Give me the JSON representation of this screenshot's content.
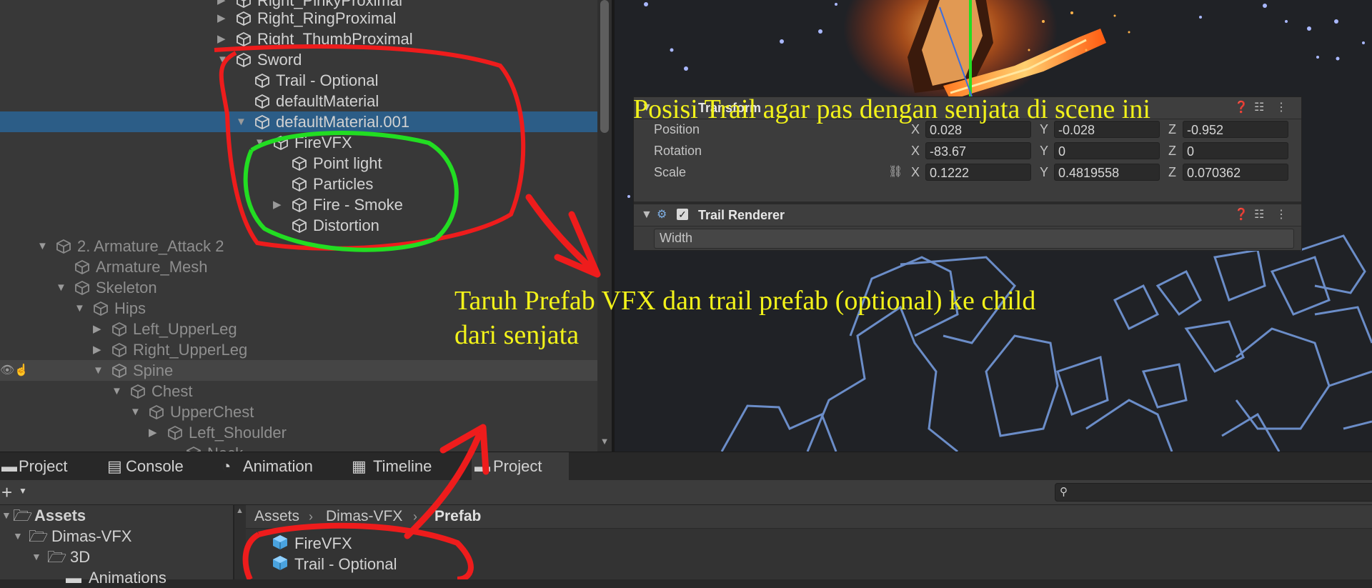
{
  "hierarchy": {
    "rows": [
      {
        "label": "Right_PinkyProximal"
      },
      {
        "label": "Right_RingProximal"
      },
      {
        "label": "Right_ThumbProximal"
      },
      {
        "label": "Sword"
      },
      {
        "label": "Trail - Optional"
      },
      {
        "label": "defaultMaterial"
      },
      {
        "label": "defaultMaterial.001"
      },
      {
        "label": "FireVFX"
      },
      {
        "label": "Point light"
      },
      {
        "label": "Particles"
      },
      {
        "label": "Fire - Smoke"
      },
      {
        "label": "Distortion"
      },
      {
        "label": "2. Armature_Attack 2"
      },
      {
        "label": "Armature_Mesh"
      },
      {
        "label": "Skeleton"
      },
      {
        "label": "Hips"
      },
      {
        "label": "Left_UpperLeg"
      },
      {
        "label": "Right_UpperLeg"
      },
      {
        "label": "Spine"
      },
      {
        "label": "Chest"
      },
      {
        "label": "UpperChest"
      },
      {
        "label": "Left_Shoulder"
      },
      {
        "label": "Neck"
      }
    ]
  },
  "inspector": {
    "transform": {
      "title": "Transform",
      "position": {
        "label": "Position",
        "x": "0.028",
        "y": "-0.028",
        "z": "-0.952"
      },
      "rotation": {
        "label": "Rotation",
        "x": "-83.67",
        "y": "0",
        "z": "0"
      },
      "scale": {
        "label": "Scale",
        "x": "0.1222",
        "y": "0.4819558",
        "z": "0.070362"
      },
      "axis_x": "X",
      "axis_y": "Y",
      "axis_z": "Z"
    },
    "trail_renderer": {
      "title": "Trail Renderer",
      "width_label": "Width"
    }
  },
  "tabs": [
    {
      "label": "Project",
      "icon": "folder-icon"
    },
    {
      "label": "Console",
      "icon": "console-icon"
    },
    {
      "label": "Animation",
      "icon": "animation-icon"
    },
    {
      "label": "Timeline",
      "icon": "timeline-icon"
    },
    {
      "label": "Project",
      "icon": "folder-icon"
    }
  ],
  "project": {
    "tree": [
      {
        "label": "Assets"
      },
      {
        "label": "Dimas-VFX"
      },
      {
        "label": "3D"
      },
      {
        "label": "Animations"
      }
    ],
    "breadcrumb": [
      "Assets",
      "Dimas-VFX",
      "Prefab"
    ],
    "files": [
      {
        "label": "FireVFX"
      },
      {
        "label": "Trail - Optional"
      }
    ]
  },
  "annotations": {
    "top": "Posisi Trail agar pas dengan senjata di scene ini",
    "mid_line1": "Taruh Prefab VFX dan trail prefab (optional) ke child",
    "mid_line2": "dari senjata"
  },
  "colors": {
    "annotation_text": "#f2f21a",
    "red_mark": "#ee1c1c",
    "green_mark": "#22dd22",
    "selection": "#2c5d87"
  }
}
